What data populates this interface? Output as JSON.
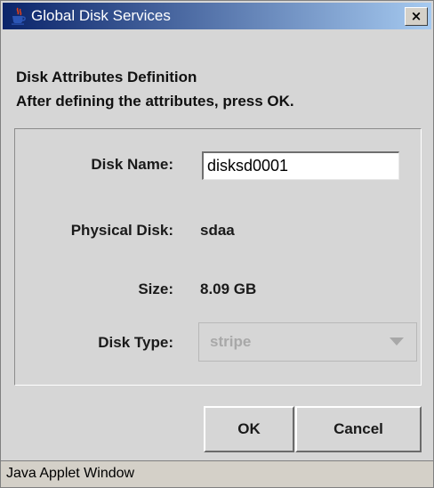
{
  "window": {
    "title": "Global Disk Services",
    "close_label": "×"
  },
  "header": {
    "line1": "Disk Attributes Definition",
    "line2": "After defining the attributes, press OK."
  },
  "form": {
    "disk_name_label": "Disk Name:",
    "disk_name_value": "disksd0001",
    "physical_disk_label": "Physical Disk:",
    "physical_disk_value": "sdaa",
    "size_label": "Size:",
    "size_value": "8.09 GB",
    "disk_type_label": "Disk Type:",
    "disk_type_value": "stripe"
  },
  "buttons": {
    "ok_label": "OK",
    "cancel_label": "Cancel"
  },
  "statusbar": {
    "text": "Java Applet Window"
  },
  "icons": {
    "title_icon": "java-cup-icon",
    "close_icon": "close-icon",
    "dropdown_icon": "chevron-down-icon"
  }
}
